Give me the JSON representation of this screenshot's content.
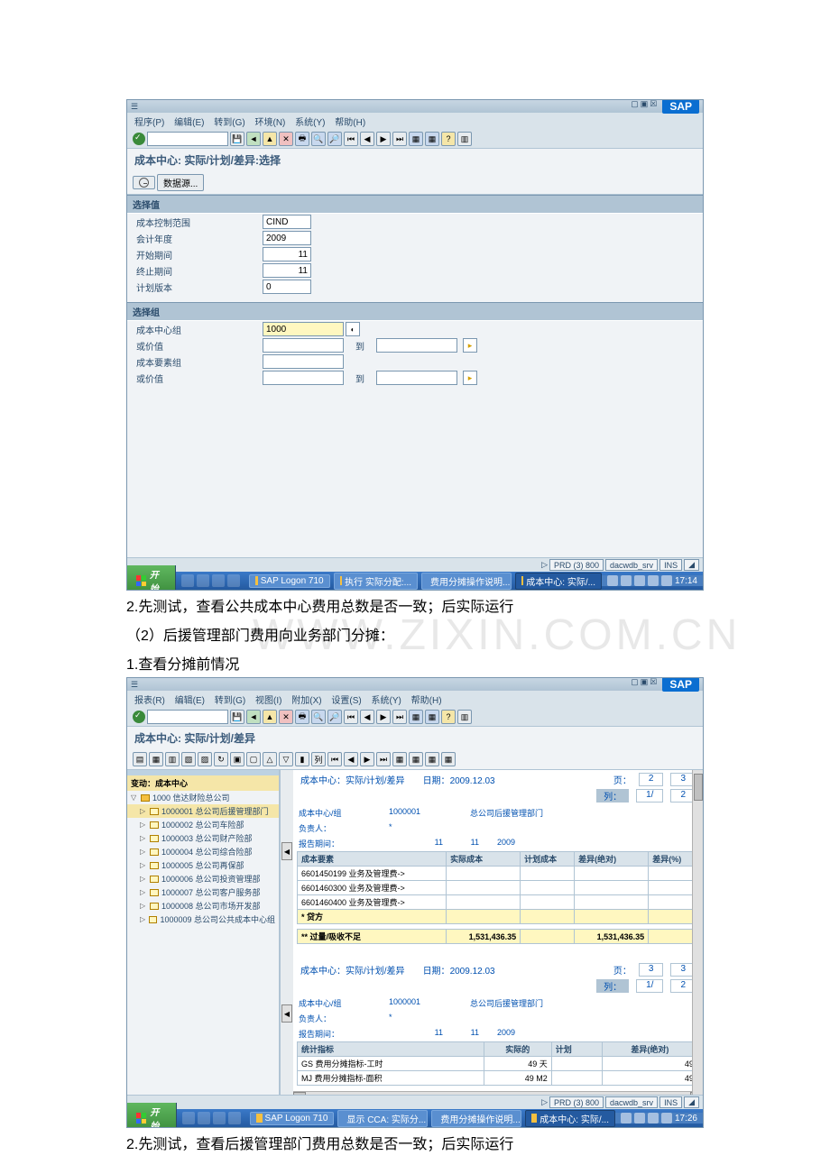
{
  "screenshot1": {
    "menubar": [
      "程序(P)",
      "编辑(E)",
      "转到(G)",
      "环境(N)",
      "系统(Y)",
      "帮助(H)"
    ],
    "screen_title": "成本中心: 实际/计划/差异:选择",
    "datasource_button": "数据源...",
    "group1_title": "选择值",
    "fields": {
      "control_area_lbl": "成本控制范围",
      "control_area_val": "CIND",
      "fiscal_year_lbl": "会计年度",
      "fiscal_year_val": "2009",
      "period_from_lbl": "开始期间",
      "period_from_val": "11",
      "period_to_lbl": "终止期间",
      "period_to_val": "11",
      "plan_version_lbl": "计划版本",
      "plan_version_val": "0"
    },
    "group2_title": "选择组",
    "sel": {
      "cc_group_lbl": "成本中心组",
      "cc_group_val": "1000",
      "or_value_lbl": "或价值",
      "to_lbl": "到",
      "ce_group_lbl": "成本要素组"
    },
    "status": {
      "sys": "PRD (3) 800",
      "server": "dacwdb_srv",
      "ins": "INS"
    },
    "taskbar": {
      "start": "开始",
      "tasks": [
        "SAP Logon 710",
        "执行 实际分配:...",
        "费用分摊操作说明...",
        "成本中心: 实际/..."
      ],
      "time": "17:14"
    }
  },
  "doc_text": {
    "line1": "2.先测试，查看公共成本中心费用总数是否一致；后实际运行",
    "line2": "（2）后援管理部门费用向业务部门分摊：",
    "line3": "1.查看分摊前情况",
    "line4": "2.先测试，查看后援管理部门费用总数是否一致；后实际运行",
    "watermark": "WWW.ZIXIN.COM.CN"
  },
  "screenshot2": {
    "menubar": [
      "报表(R)",
      "编辑(E)",
      "转到(G)",
      "视图(I)",
      "附加(X)",
      "设置(S)",
      "系统(Y)",
      "帮助(H)"
    ],
    "screen_title": "成本中心: 实际/计划/差异",
    "tree": {
      "header": "变动：成本中心",
      "root": "1000 信达财险总公司",
      "nodes": [
        "1000001 总公司后援管理部门",
        "1000002 总公司车险部",
        "1000003 总公司财产险部",
        "1000004 总公司综合险部",
        "1000005 总公司再保部",
        "1000006 总公司投资管理部",
        "1000007 总公司客户服务部",
        "1000008 总公司市场开发部",
        "1000009 总公司公共成本中心组"
      ]
    },
    "report": {
      "title": "成本中心：实际/计划/差异",
      "date_lbl": "日期：",
      "date": "2009.12.03",
      "page_lbl": "页：",
      "col_lbl": "列：",
      "page_a": "2",
      "page_b": "3",
      "col_a": "1/",
      "col_b": "2",
      "page2_a": "3",
      "page2_b": "3",
      "cc_group_lbl": "成本中心/组",
      "cc_group_val": "1000001",
      "cc_name": "总公司后援管理部门",
      "resp_lbl": "负责人：",
      "resp_val": "*",
      "period_lbl": "报告期间：",
      "period_from": "11",
      "period_to": "11",
      "year": "2009",
      "tbl1": {
        "headers": [
          "成本要素",
          "实际成本",
          "计划成本",
          "差异(绝对)",
          "差异(%)"
        ],
        "rows": [
          [
            "6601450199  业务及管理费->",
            "",
            "",
            "",
            ""
          ],
          [
            "6601460300  业务及管理费->",
            "",
            "",
            "",
            ""
          ],
          [
            "6601460400  业务及管理费->",
            "",
            "",
            "",
            ""
          ]
        ],
        "credit_lbl": "*  贷方",
        "over_lbl": "** 过量/吸收不足",
        "over_actual": "1,531,436.35",
        "over_var": "1,531,436.35"
      },
      "tbl2": {
        "headers": [
          "统计指标",
          "实际的",
          "计划",
          "差异(绝对)"
        ],
        "rows": [
          [
            "GS  费用分摊指标-工时",
            "49  天",
            "",
            "49"
          ],
          [
            "MJ  费用分摊指标-面积",
            "49  M2",
            "",
            "49"
          ]
        ]
      }
    },
    "status": {
      "sys": "PRD (3) 800",
      "server": "dacwdb_srv",
      "ins": "INS"
    },
    "taskbar": {
      "start": "开始",
      "tasks": [
        "SAP Logon 710",
        "显示 CCA: 实际分...",
        "费用分摊操作说明...",
        "成本中心: 实际/..."
      ],
      "time": "17:26"
    }
  }
}
